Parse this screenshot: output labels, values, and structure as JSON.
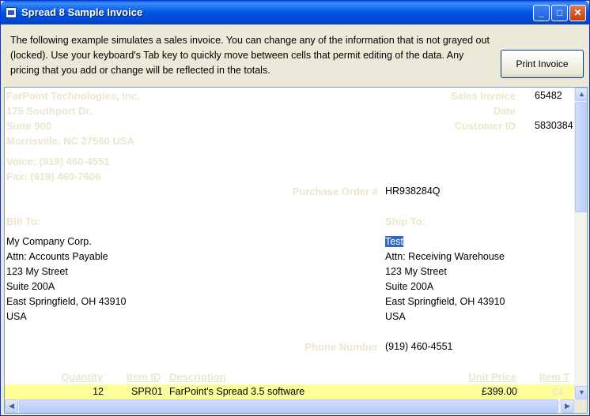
{
  "window": {
    "title": "Spread 8 Sample Invoice"
  },
  "titlebar": {
    "minimize": "_",
    "maximize": "□",
    "close": "✕"
  },
  "description": "The following example simulates a sales invoice. You can change any of the information that is not grayed out (locked). Use your keyboard's Tab key to quickly move between cells that permit editing of the data. Any pricing that you add or change will be reflected in the totals.",
  "print_button": "Print Invoice",
  "company": {
    "name": "FarPoint Technologies, Inc.",
    "street": "175 Southport Dr.",
    "suite": "Suite 900",
    "city": "Morrisville, NC 27560  USA",
    "voice": "Voice: (919) 460-4551",
    "fax": "Fax: (919) 460-7606"
  },
  "invoice_meta": {
    "sales_invoice_label": "Sales Invoice",
    "sales_invoice_value": "65482",
    "date_label": "Date",
    "date_value": "",
    "customer_id_label": "Customer ID",
    "customer_id_value": "5830384",
    "po_label": "Purchase Order #",
    "po_value": "HR938284Q"
  },
  "bill_to": {
    "label": "Bill To:",
    "lines": [
      "My Company Corp.",
      "Attn: Accounts Payable",
      "123 My Street",
      "Suite 200A",
      "East Springfield, OH 43910",
      "USA"
    ]
  },
  "ship_to": {
    "label": "Ship To:",
    "lines": [
      "Test",
      "Attn: Receiving Warehouse",
      "123 My Street",
      "Suite 200A",
      "East Springfield, OH 43910",
      "USA"
    ]
  },
  "phone": {
    "label": "Phone Number",
    "value": "(919) 460-4551"
  },
  "items_header": {
    "quantity": "Quantity",
    "item_id": "Item ID",
    "description": "Description",
    "unit_price": "Unit Price",
    "item_total": "Item T"
  },
  "items": [
    {
      "quantity": "12",
      "item_id": "SPR01",
      "description": "FarPoint's Spread 3.5 software",
      "unit_price": "£399.00",
      "item_total": "£4"
    }
  ],
  "scroll": {
    "up": "▲",
    "down": "▼",
    "left": "◀",
    "right": "▶"
  }
}
